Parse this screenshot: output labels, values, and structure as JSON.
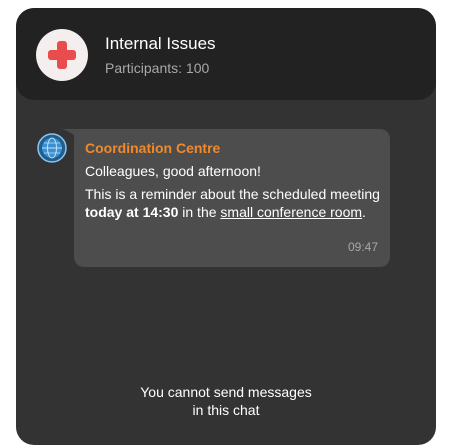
{
  "header": {
    "title": "Internal Issues",
    "subtitle": "Participants: 100",
    "avatar_icon": "red-cross-icon",
    "avatar_color": "#e84c4c"
  },
  "message": {
    "sender": "Coordination Centre",
    "sender_color": "#ef8a2c",
    "sender_avatar_icon": "globe-icon",
    "greeting": "Colleagues, good afternoon!",
    "text_before": "This is a reminder about the scheduled meeting ",
    "bold_text": "today at 14:30",
    "text_middle": " in the ",
    "link_text": "small conference room",
    "text_after": ".",
    "time": "09:47"
  },
  "footer": {
    "line1": "You cannot send messages",
    "line2": "in this chat"
  }
}
